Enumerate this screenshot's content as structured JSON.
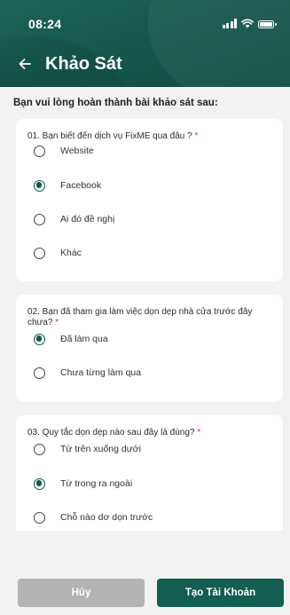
{
  "status_bar": {
    "time": "08:24"
  },
  "header": {
    "title": "Khảo Sát"
  },
  "intro": "Bạn vui lòng hoàn thành bài khảo sát sau:",
  "questions": [
    {
      "text": "01. Bạn biết đến dịch vụ FixME qua đâu ?",
      "required": "*",
      "options": [
        "Website",
        "Facebook",
        "Ai đó đề nghị",
        "Khác"
      ],
      "selected": "Facebook"
    },
    {
      "text": "02. Bạn đã tham gia làm việc dọn dẹp nhà cửa trước đây chưa?",
      "required": "*",
      "options": [
        "Đã làm qua",
        "Chưa từng làm qua"
      ],
      "selected": "Đã làm qua"
    },
    {
      "text": "03. Quy tắc dọn dẹp nào sau đây là đúng?",
      "required": "*",
      "options": [
        "Từ trên xuống dưới",
        "Từ trong ra ngoài",
        "Chỗ nào dơ dọn trước"
      ],
      "selected": "Từ trong ra ngoài"
    }
  ],
  "footer": {
    "cancel_label": "Hủy",
    "create_label": "Tạo Tài Khoản"
  },
  "colors": {
    "primary": "#125f52",
    "cancel": "#b4b4b4",
    "required": "#d9322f",
    "background": "#f1f2f1"
  }
}
